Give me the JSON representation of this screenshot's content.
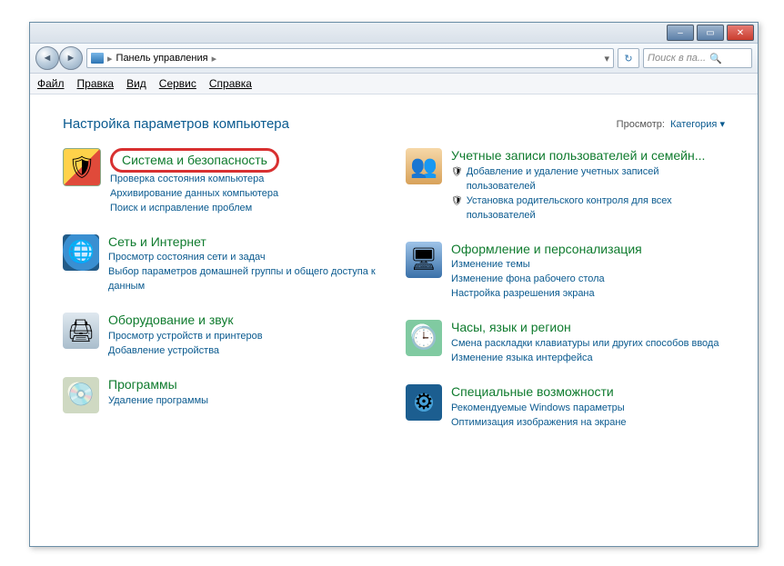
{
  "window": {
    "breadcrumb_root": "Панель управления",
    "search_placeholder": "Поиск в па...",
    "buttons": {
      "min": "–",
      "max": "▭",
      "close": "✕"
    }
  },
  "menu": {
    "file": "Файл",
    "edit": "Правка",
    "view": "Вид",
    "tools": "Сервис",
    "help": "Справка"
  },
  "heading": "Настройка параметров компьютера",
  "viewby": {
    "label": "Просмотр:",
    "value": "Категория",
    "caret": "▾"
  },
  "left": [
    {
      "key": "system-security",
      "head": "Система и безопасность",
      "iconEmoji": "🛡",
      "subs": [
        "Проверка состояния компьютера",
        "Архивирование данных компьютера",
        "Поиск и исправление проблем"
      ]
    },
    {
      "key": "network",
      "head": "Сеть и Интернет",
      "iconEmoji": "🌐",
      "subs": [
        "Просмотр состояния сети и задач",
        "Выбор параметров домашней группы и общего доступа к данным"
      ]
    },
    {
      "key": "hardware",
      "head": "Оборудование и звук",
      "iconEmoji": "🖨",
      "subs": [
        "Просмотр устройств и принтеров",
        "Добавление устройства"
      ]
    },
    {
      "key": "programs",
      "head": "Программы",
      "iconEmoji": "💿",
      "subs": [
        "Удаление программы"
      ]
    }
  ],
  "right": [
    {
      "key": "accounts",
      "head": "Учетные записи пользователей и семейн...",
      "iconEmoji": "👥",
      "subs": [
        {
          "shield": true,
          "text": "Добавление и удаление учетных записей пользователей"
        },
        {
          "shield": true,
          "text": "Установка родительского контроля для всех пользователей"
        }
      ]
    },
    {
      "key": "appearance",
      "head": "Оформление и персонализация",
      "iconEmoji": "🖥",
      "subs": [
        "Изменение темы",
        "Изменение фона рабочего стола",
        "Настройка разрешения экрана"
      ]
    },
    {
      "key": "clock",
      "head": "Часы, язык и регион",
      "iconEmoji": "🕒",
      "subs": [
        "Смена раскладки клавиатуры или других способов ввода",
        "Изменение языка интерфейса"
      ]
    },
    {
      "key": "access",
      "head": "Специальные возможности",
      "iconEmoji": "⚙",
      "subs": [
        "Рекомендуемые Windows параметры",
        "Оптимизация изображения на экране"
      ]
    }
  ]
}
